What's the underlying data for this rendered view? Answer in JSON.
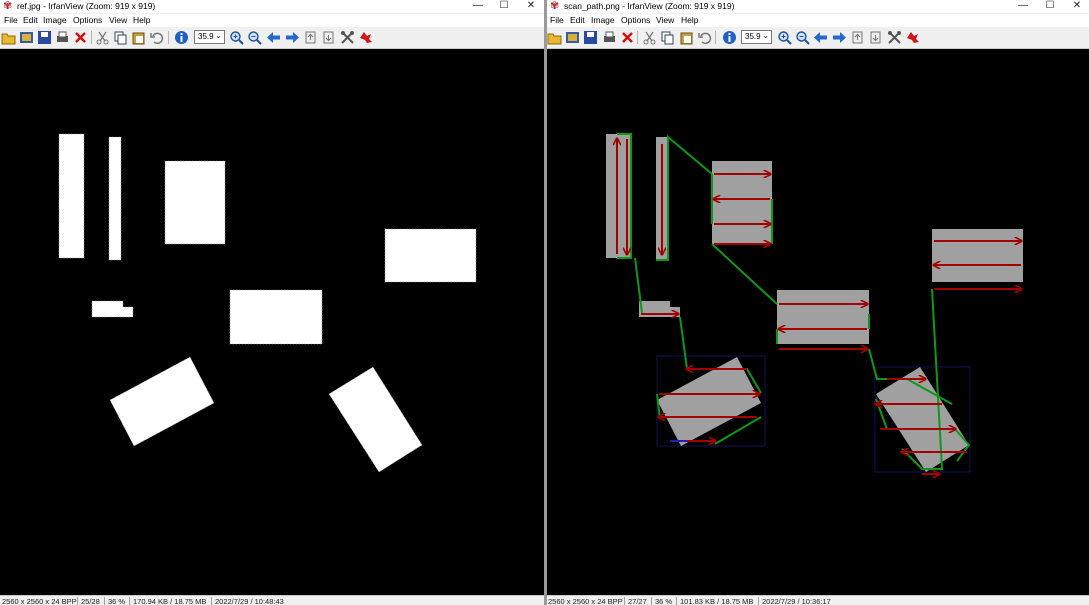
{
  "left": {
    "title": "ref.jpg - IrfanView (Zoom: 919 x 919)",
    "menu": [
      "File",
      "Edit",
      "Image",
      "Options",
      "View",
      "Help"
    ],
    "zoom_value": "35.9",
    "status": [
      "2560 x 2560 x 24 BPP",
      "25/28",
      "36 %",
      "170.94 KB / 18.75 MB",
      "2022/7/29 / 10:48:43"
    ]
  },
  "right": {
    "title": "scan_path.png - IrfanView (Zoom: 919 x 919)",
    "menu": [
      "File",
      "Edit",
      "Image",
      "Options",
      "View",
      "Help"
    ],
    "zoom_value": "35.9",
    "status": [
      "2560 x 2560 x 24 BPP",
      "27/27",
      "36 %",
      "101.83 KB / 18.75 MB",
      "2022/7/29 / 10:36:17"
    ]
  },
  "window_buttons": {
    "minimize": "—",
    "maximize": "☐",
    "close": "✕"
  },
  "icons": [
    "open-folder-icon",
    "slideshow-icon",
    "save-icon",
    "print-icon",
    "delete-icon",
    "cut-icon",
    "copy-icon",
    "paste-icon",
    "undo-icon",
    "info-icon",
    "zoom-in-icon",
    "zoom-out-icon",
    "previous-icon",
    "next-icon",
    "first-page-icon",
    "last-page-icon",
    "settings-icon",
    "exit-icon"
  ],
  "colors": {
    "shape_fill": "#ffffff",
    "scan_fill": "#a0a0a0",
    "path_green": "#0b9a17",
    "arrow_red": "#a30000",
    "title_icon": "#b3262b"
  }
}
